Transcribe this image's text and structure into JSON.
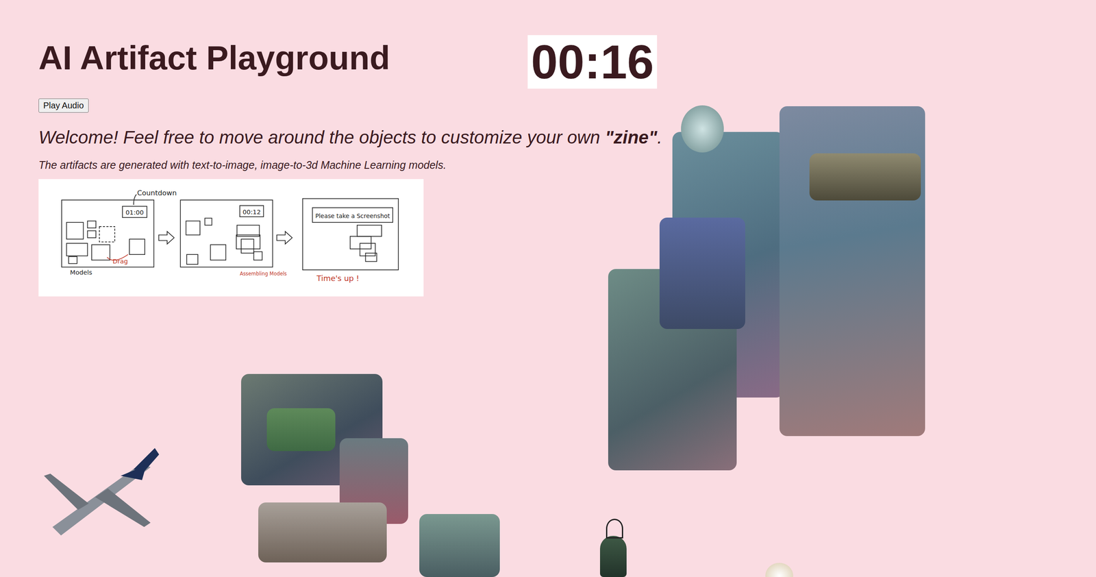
{
  "page": {
    "title": "AI Artifact Playground"
  },
  "timer": {
    "text": "00:16"
  },
  "buttons": [
    {
      "label": "Play Audio"
    }
  ],
  "welcome": {
    "before": "Welcome! Feel free to move around the objects to customize your own ",
    "emphasis": "\"zine\"",
    "after": "."
  },
  "note": "The artifacts are generated with text-to-image, image-to-3d Machine Learning models.",
  "diagram": {
    "countdown_label": "Countdown",
    "start_time": "01:00",
    "models_label": "Models",
    "drag_label": "Drag",
    "mid_time": "00:12",
    "assembling_label": "Assembling Models",
    "prompt": "Please take a Screenshot",
    "end_label": "Time's up !"
  }
}
